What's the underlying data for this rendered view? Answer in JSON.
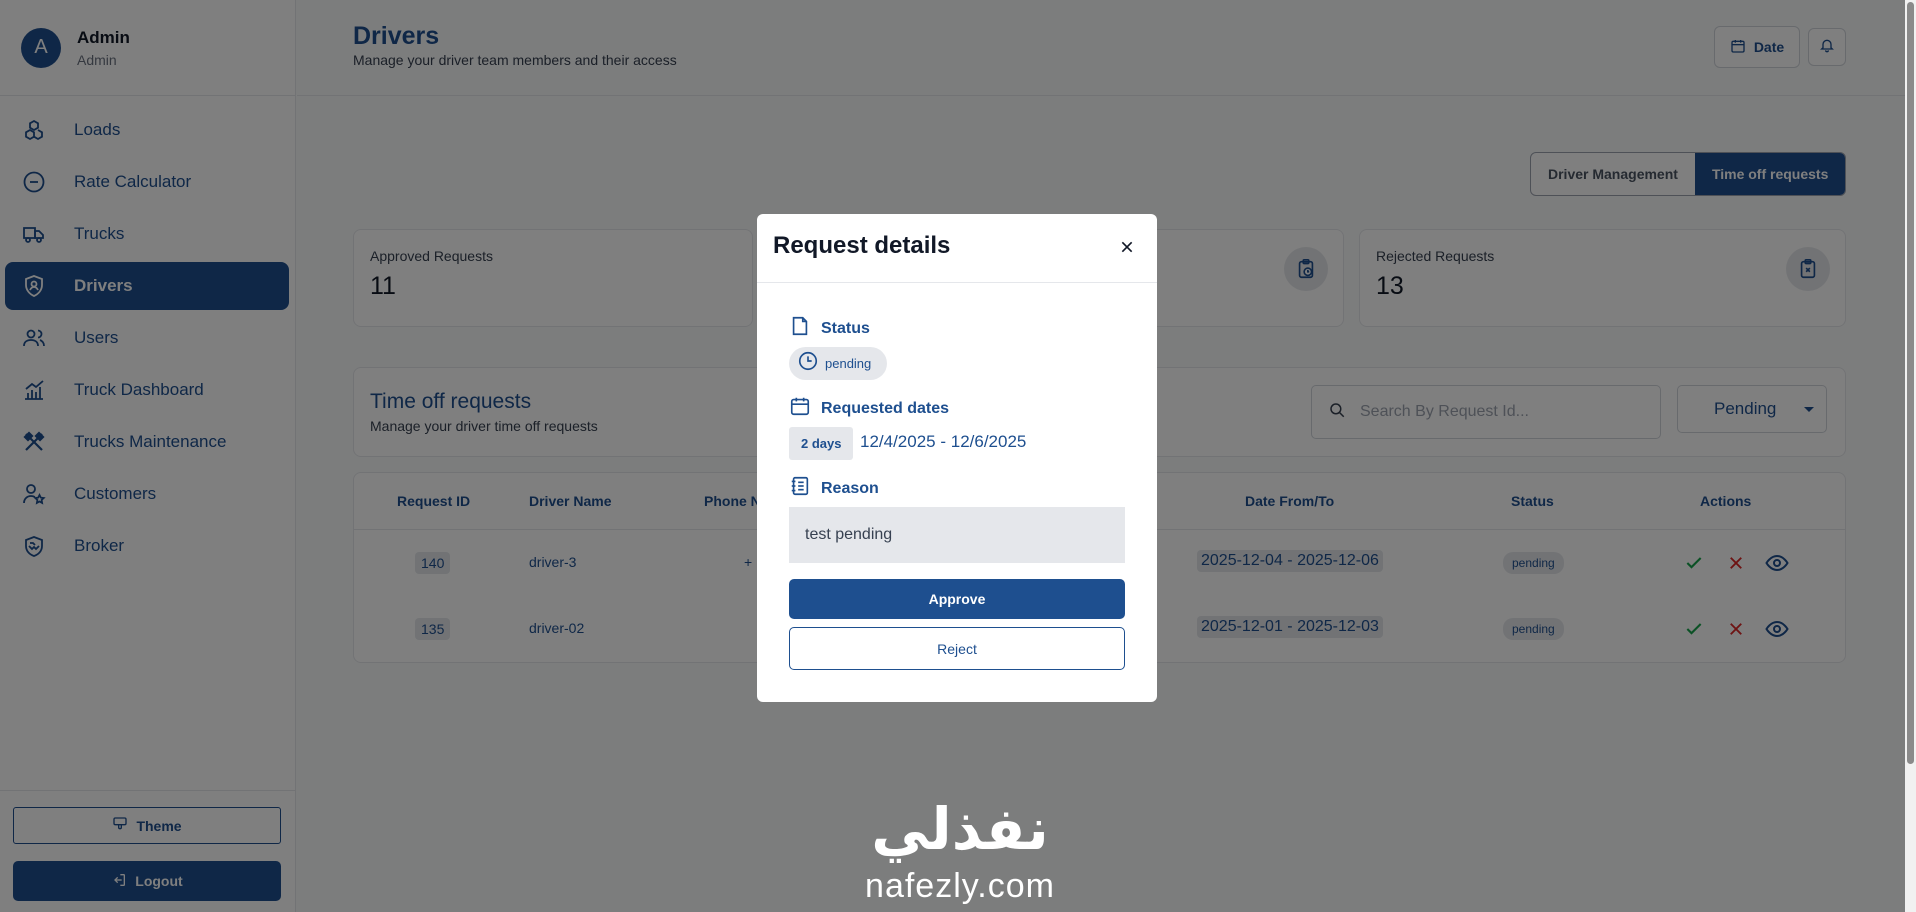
{
  "profile": {
    "initial": "A",
    "name": "Admin",
    "role": "Admin"
  },
  "nav": [
    {
      "label": "Loads",
      "icon": "boxes-icon"
    },
    {
      "label": "Rate Calculator",
      "icon": "minus-circle-icon"
    },
    {
      "label": "Trucks",
      "icon": "truck-icon"
    },
    {
      "label": "Drivers",
      "icon": "shield-icon",
      "active": true
    },
    {
      "label": "Users",
      "icon": "users-icon"
    },
    {
      "label": "Truck Dashboard",
      "icon": "chart-icon"
    },
    {
      "label": "Trucks Maintenance",
      "icon": "tools-icon"
    },
    {
      "label": "Customers",
      "icon": "user-star-icon"
    },
    {
      "label": "Broker",
      "icon": "handshake-icon"
    }
  ],
  "sidebar_bottom": {
    "theme_label": "Theme",
    "logout_label": "Logout"
  },
  "header": {
    "title": "Drivers",
    "subtitle": "Manage your driver team members and their access",
    "date_label": "Date"
  },
  "tabs": [
    {
      "label": "Driver Management",
      "active": false
    },
    {
      "label": "Time off requests",
      "active": true
    }
  ],
  "stats": {
    "approved": {
      "label": "Approved Requests",
      "value": "11"
    },
    "rejected": {
      "label": "Rejected Requests",
      "value": "13"
    }
  },
  "section": {
    "title": "Time off requests",
    "subtitle": "Manage your driver time off requests",
    "search_placeholder": "Search By Request Id...",
    "filter_value": "Pending"
  },
  "table": {
    "headers": {
      "request_id": "Request ID",
      "driver_name": "Driver Name",
      "phone": "Phone N",
      "date_range": "Date From/To",
      "status": "Status",
      "actions": "Actions"
    },
    "rows": [
      {
        "id": "140",
        "driver": "driver-3",
        "phone": "+",
        "range": "2025-12-04 - 2025-12-06",
        "status": "pending"
      },
      {
        "id": "135",
        "driver": "driver-02",
        "phone": "",
        "range": "2025-12-01 - 2025-12-03",
        "status": "pending"
      }
    ]
  },
  "modal": {
    "title": "Request details",
    "status_label": "Status",
    "status_value": "pending",
    "dates_label": "Requested dates",
    "days": "2 days",
    "dates": "12/4/2025 - 12/6/2025",
    "reason_label": "Reason",
    "reason": "test pending",
    "approve_label": "Approve",
    "reject_label": "Reject"
  },
  "watermark": {
    "arabic": "نفذلي",
    "latin": "nafezly.com"
  },
  "colors": {
    "primary": "#1e4f8f",
    "approve": "#16a34a",
    "reject": "#dc2626"
  }
}
